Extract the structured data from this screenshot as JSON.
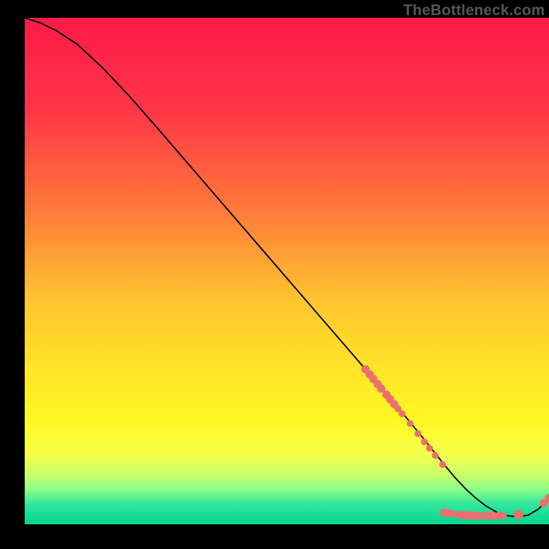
{
  "watermark": "TheBottleneck.com",
  "chart_data": {
    "type": "line",
    "title": "",
    "xlabel": "",
    "ylabel": "",
    "xlim": [
      0,
      100
    ],
    "ylim": [
      0,
      100
    ],
    "gradient_stops": [
      {
        "offset": 0,
        "color": "#ff1a49"
      },
      {
        "offset": 18,
        "color": "#ff3547"
      },
      {
        "offset": 38,
        "color": "#ff7a3a"
      },
      {
        "offset": 55,
        "color": "#ffc22f"
      },
      {
        "offset": 70,
        "color": "#ffe627"
      },
      {
        "offset": 80,
        "color": "#fff826"
      },
      {
        "offset": 86,
        "color": "#f7ff4a"
      },
      {
        "offset": 90,
        "color": "#ccff66"
      },
      {
        "offset": 93,
        "color": "#8dff86"
      },
      {
        "offset": 96,
        "color": "#33e79b"
      },
      {
        "offset": 100,
        "color": "#00d68f"
      }
    ],
    "series": [
      {
        "name": "curve",
        "type": "line",
        "color": "#000000",
        "x": [
          0,
          3,
          6,
          10,
          15,
          20,
          25,
          30,
          35,
          40,
          45,
          50,
          55,
          60,
          65,
          70,
          73,
          76,
          78,
          80,
          82,
          84,
          86,
          88,
          90,
          92,
          94,
          96,
          98,
          100
        ],
        "y": [
          100,
          99,
          97.5,
          94.8,
          90,
          84.5,
          78.6,
          72.6,
          66.6,
          60.6,
          54.6,
          48.6,
          42.6,
          36.6,
          30.6,
          24.5,
          20.8,
          17,
          14.4,
          11.8,
          9.3,
          7.1,
          5.2,
          3.6,
          2.4,
          1.7,
          1.5,
          1.8,
          3.0,
          5.2
        ]
      },
      {
        "name": "markers",
        "type": "scatter",
        "color": "#ef6e6e",
        "points": [
          {
            "x": 65,
            "y": 30.6,
            "r": 6
          },
          {
            "x": 65.8,
            "y": 29.6,
            "r": 6
          },
          {
            "x": 66.5,
            "y": 28.7,
            "r": 6
          },
          {
            "x": 67.3,
            "y": 27.7,
            "r": 6
          },
          {
            "x": 68.0,
            "y": 26.8,
            "r": 6
          },
          {
            "x": 69.0,
            "y": 25.6,
            "r": 6
          },
          {
            "x": 69.7,
            "y": 24.7,
            "r": 6
          },
          {
            "x": 70.5,
            "y": 23.7,
            "r": 6
          },
          {
            "x": 71.2,
            "y": 22.8,
            "r": 5
          },
          {
            "x": 72.0,
            "y": 21.8,
            "r": 5
          },
          {
            "x": 73.5,
            "y": 19.9,
            "r": 5
          },
          {
            "x": 75.0,
            "y": 17.9,
            "r": 5
          },
          {
            "x": 76.2,
            "y": 16.3,
            "r": 5
          },
          {
            "x": 77.2,
            "y": 15.0,
            "r": 5
          },
          {
            "x": 78.3,
            "y": 13.6,
            "r": 5
          },
          {
            "x": 79.7,
            "y": 11.8,
            "r": 5
          },
          {
            "x": 80.0,
            "y": 2.3,
            "r": 6
          },
          {
            "x": 80.8,
            "y": 2.2,
            "r": 6
          },
          {
            "x": 81.7,
            "y": 2.1,
            "r": 5
          },
          {
            "x": 83.0,
            "y": 1.9,
            "r": 6
          },
          {
            "x": 83.9,
            "y": 1.8,
            "r": 6
          },
          {
            "x": 84.7,
            "y": 1.8,
            "r": 6
          },
          {
            "x": 85.4,
            "y": 1.7,
            "r": 6
          },
          {
            "x": 86.6,
            "y": 1.7,
            "r": 6
          },
          {
            "x": 88.0,
            "y": 1.7,
            "r": 6
          },
          {
            "x": 89.2,
            "y": 1.7,
            "r": 6
          },
          {
            "x": 90.5,
            "y": 1.7,
            "r": 6
          },
          {
            "x": 91.3,
            "y": 1.7,
            "r": 5
          },
          {
            "x": 94.2,
            "y": 1.9,
            "r": 7
          },
          {
            "x": 99.0,
            "y": 4.2,
            "r": 6
          },
          {
            "x": 100.0,
            "y": 5.2,
            "r": 6
          }
        ]
      }
    ]
  }
}
